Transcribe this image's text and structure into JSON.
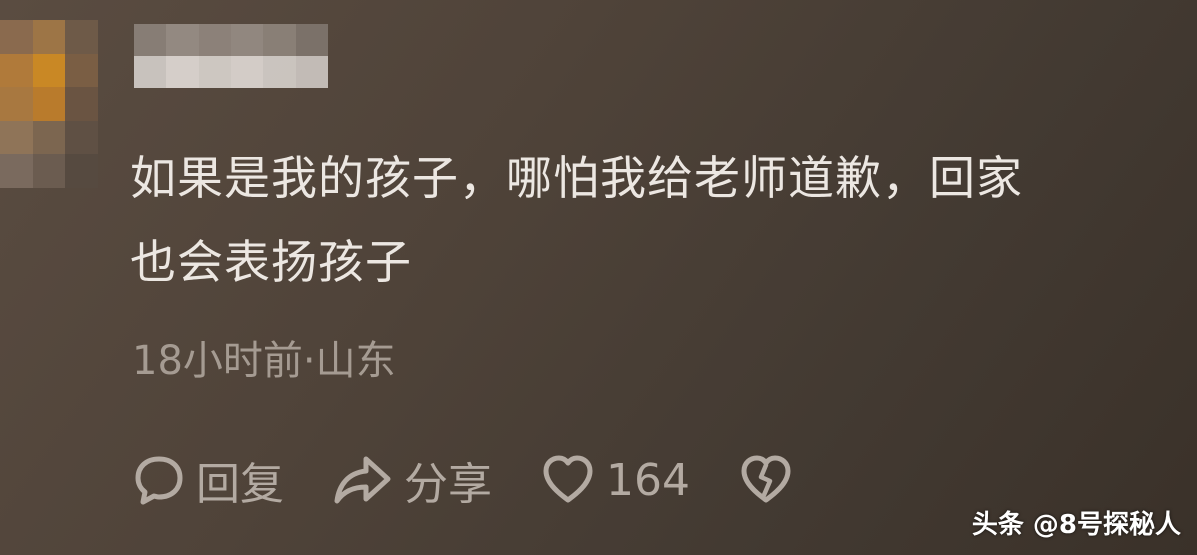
{
  "comment": {
    "avatar_icon": "avatar-pixelated",
    "username_icon": "username-blurred",
    "text_line1": "如果是我的孩子，哪怕我给老师道歉，回家",
    "text_line2": "也会表扬孩子",
    "time_location": "18小时前·山东"
  },
  "actions": {
    "reply_label": "回复",
    "share_label": "分享",
    "like_count": "164",
    "reply_icon": "speech-bubble-icon",
    "share_icon": "share-arrow-icon",
    "like_icon": "heart-icon",
    "dislike_icon": "broken-heart-icon"
  },
  "watermark": {
    "text": "头条 @8号探秘人"
  },
  "colors": {
    "background": "#4f4339",
    "text": "#ece7e2",
    "meta": "#a59b92",
    "action": "#b3aaa2"
  }
}
